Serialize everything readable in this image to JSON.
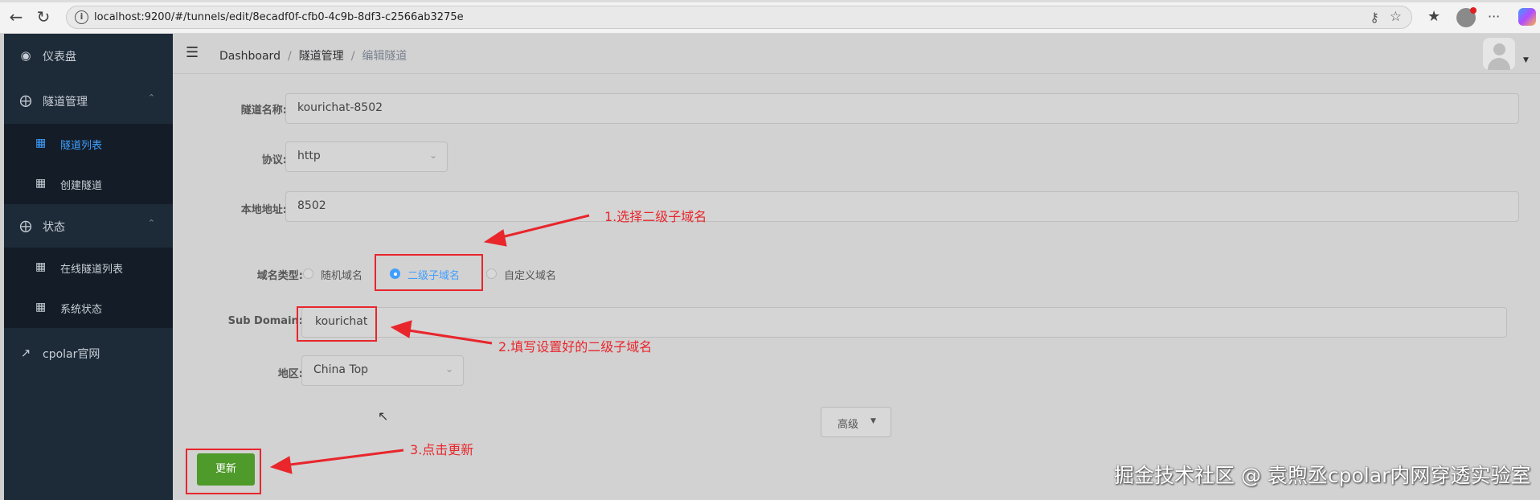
{
  "browser": {
    "url": "localhost:9200/#/tunnels/edit/8ecadf0f-cfb0-4c9b-8df3-c2566ab3275e"
  },
  "sidebar": {
    "items": [
      {
        "label": "仪表盘",
        "icon": "dashboard-icon"
      },
      {
        "label": "隧道管理",
        "icon": "plus-circle-icon",
        "expanded": true,
        "children": [
          {
            "label": "隧道列表",
            "icon": "grid-icon",
            "active": true
          },
          {
            "label": "创建隧道",
            "icon": "grid-icon"
          }
        ]
      },
      {
        "label": "状态",
        "icon": "plus-circle-icon",
        "expanded": true,
        "children": [
          {
            "label": "在线隧道列表",
            "icon": "grid-icon"
          },
          {
            "label": "系统状态",
            "icon": "grid-icon"
          }
        ]
      },
      {
        "label": "cpolar官网",
        "icon": "external-link-icon"
      }
    ]
  },
  "breadcrumb": [
    "Dashboard",
    "隧道管理",
    "编辑隧道"
  ],
  "form": {
    "tunnel_name_label": "隧道名称:",
    "tunnel_name": "kourichat-8502",
    "protocol_label": "协议:",
    "protocol": "http",
    "local_address_label": "本地地址:",
    "local_address": "8502",
    "domain_type_label": "域名类型:",
    "domain_types": [
      "随机域名",
      "二级子域名",
      "自定义域名"
    ],
    "domain_type_selected": "二级子域名",
    "subdomain_label": "Sub Domain:",
    "subdomain": "kourichat",
    "region_label": "地区:",
    "region": "China Top",
    "advanced_label": "高级",
    "update_label": "更新"
  },
  "annotations": {
    "step1": "1.选择二级子域名",
    "step2": "2.填写设置好的二级子域名",
    "step3": "3.点击更新",
    "color": "#e8262c"
  },
  "watermark": "掘金技术社区 @ 袁煦丞cpolar内网穿透实验室",
  "colors": {
    "sidebar_bg": "#1d2a38",
    "accent": "#409eff",
    "update_button": "#4e9a2a"
  }
}
